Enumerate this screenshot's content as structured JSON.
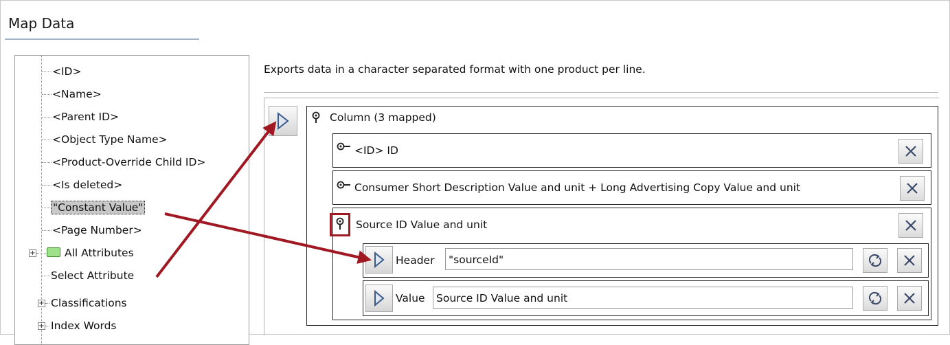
{
  "title": "Map Data",
  "tree": {
    "items": [
      {
        "label": "<ID>"
      },
      {
        "label": "<Name>"
      },
      {
        "label": "<Parent ID>"
      },
      {
        "label": "<Object Type Name>"
      },
      {
        "label": "<Product-Override Child ID>"
      },
      {
        "label": "<Is deleted>"
      },
      {
        "label": "\"Constant Value\"",
        "selected": true
      },
      {
        "label": "<Page Number>"
      },
      {
        "label": "All Attributes",
        "expandable": true,
        "icon": "folder-icon"
      },
      {
        "label": "Select Attribute"
      },
      {
        "label": "Classifications",
        "expandable": true
      },
      {
        "label": "Index Words",
        "expandable": true
      }
    ]
  },
  "description": "Exports data in a character separated format with one product per line.",
  "column": {
    "label": "Column (3 mapped)",
    "rows": [
      {
        "label": "<ID> ID"
      },
      {
        "label": "Consumer Short Description Value and unit + Long Advertising Copy Value and unit"
      },
      {
        "label": "Source ID Value and unit"
      }
    ],
    "header": {
      "label": "Header",
      "value": "\"sourceId\""
    },
    "value": {
      "label": "Value",
      "value": "Source ID Value and unit"
    }
  },
  "colors": {
    "annotation": "#a01822"
  }
}
